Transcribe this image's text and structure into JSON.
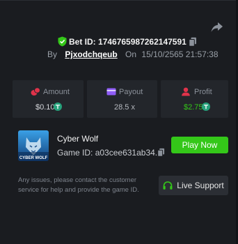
{
  "bet": {
    "label": "Bet ID:",
    "id": "1746765987262147591",
    "by_label": "By",
    "username": "Pjxodchqeub",
    "on_label": "On",
    "date": "15/10/2565 21:57:38"
  },
  "stats": {
    "amount": {
      "label": "Amount",
      "value": "$0.10",
      "icon": "coins-icon",
      "color": "#e0334a"
    },
    "payout": {
      "label": "Payout",
      "value": "28.5 x",
      "icon": "wallet-icon",
      "color": "#8f5cf7"
    },
    "profit": {
      "label": "Profit",
      "value": "$2.75",
      "icon": "user-icon",
      "color": "#e0334a",
      "value_color": "#34c719"
    }
  },
  "game": {
    "name": "Cyber Wolf",
    "id_label": "Game ID:",
    "id": "a03cee631ab34...",
    "play_label": "Play Now",
    "thumb_text": "CYBER WOLF"
  },
  "support": {
    "note": "Any issues, please contact the customer service for help and provide the game ID.",
    "button_label": "Live Support"
  },
  "colors": {
    "accent": "#34c719",
    "background": "#1a1c20",
    "card": "#23262b",
    "tether": "#26a17b"
  }
}
